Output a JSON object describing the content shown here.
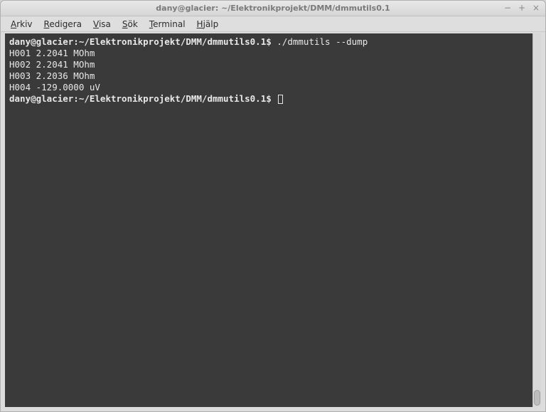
{
  "window": {
    "title": "dany@glacier: ~/Elektronikprojekt/DMM/dmmutils0.1"
  },
  "window_controls": {
    "minimize": "−",
    "maximize": "+",
    "close": "×"
  },
  "menubar": {
    "arkiv": {
      "underline": "A",
      "rest": "rkiv"
    },
    "redigera": {
      "underline": "R",
      "rest": "edigera"
    },
    "visa": {
      "underline": "V",
      "rest": "isa"
    },
    "sok": {
      "underline": "S",
      "rest": "ök"
    },
    "terminal": {
      "underline": "T",
      "rest": "erminal"
    },
    "hjalp": {
      "underline": "H",
      "rest": "jälp"
    }
  },
  "terminal": {
    "prompt1_path": "dany@glacier:~/Elektronikprojekt/DMM/dmmutils0.1$",
    "command1": " ./dmmutils --dump",
    "lines": [
      "H001 2.2041 MOhm",
      "H002 2.2041 MOhm",
      "H003 2.2036 MOhm",
      "H004 -129.0000 uV"
    ],
    "prompt2_path": "dany@glacier:~/Elektronikprojekt/DMM/dmmutils0.1$"
  }
}
